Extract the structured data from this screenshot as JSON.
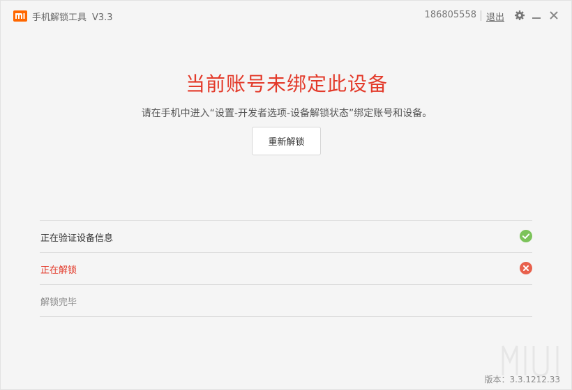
{
  "titlebar": {
    "app_name": "手机解锁工具",
    "version": "V3.3",
    "account": "186805558",
    "logout_label": "退出",
    "icons": [
      "mi-logo-icon",
      "gear-icon",
      "minimize-icon",
      "close-icon"
    ]
  },
  "main": {
    "title": "当前账号未绑定此设备",
    "description": "请在手机中进入“设置-开发者选项-设备解锁状态”绑定账号和设备。",
    "retry_label": "重新解锁"
  },
  "steps": [
    {
      "label": "正在验证设备信息",
      "status": "done"
    },
    {
      "label": "正在解锁",
      "status": "error"
    },
    {
      "label": "解锁完毕",
      "status": "pending"
    }
  ],
  "footer": {
    "version_text": "版本：3.3.1212.33"
  },
  "colors": {
    "brand": "#ff6700",
    "error": "#e33a2a",
    "success": "#7cc35a",
    "error_icon": "#e8604c"
  }
}
